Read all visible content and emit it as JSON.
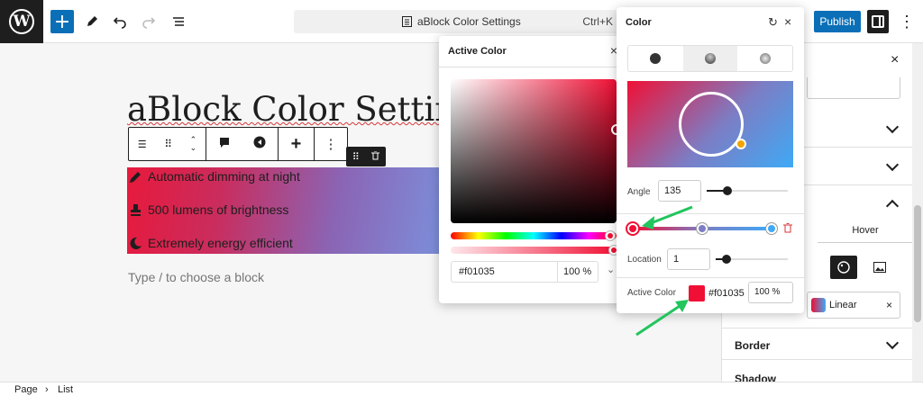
{
  "topbar": {
    "logo_text": "W",
    "doc_title": "aBlock Color Settings",
    "shortcut": "Ctrl+K",
    "publish_label": "Publish",
    "add_label": "+",
    "kebab": "⋮"
  },
  "editor": {
    "title": "aBlock Color Setting",
    "list_items": [
      {
        "icon": "pencil-icon",
        "text": "Automatic dimming at night"
      },
      {
        "icon": "lamp-icon",
        "text": "500 lumens of brightness"
      },
      {
        "icon": "moon-star-icon",
        "text": "Extremely energy efficient"
      }
    ],
    "placeholder": "Type / to choose a block"
  },
  "active_color_popover": {
    "title": "Active Color",
    "hex": "#f01035",
    "opacity": "100 %",
    "close": "×"
  },
  "color_popover": {
    "title": "Color",
    "angle_label": "Angle",
    "angle_value": "135",
    "angle_slider_level": 0.25,
    "location_label": "Location",
    "location_value": "1",
    "location_slider_level": 0.01,
    "active_color_label": "Active Color",
    "active_color_hex": "#f01035",
    "active_color_opacity": "100 %",
    "close": "×",
    "gradient_stops": [
      "#f01035",
      "#7c7dc4",
      "#3fa9f5"
    ]
  },
  "sidebar": {
    "close": "×",
    "hover_tab": "Hover",
    "gradient_type": "Linear",
    "border_label": "Border",
    "shadow_label": "Shadow"
  },
  "footer": {
    "crumb_page": "Page",
    "crumb_list": "List"
  },
  "colors": {
    "accent": "#0a6fb7",
    "active": "#f01035",
    "arrow": "#22c55e"
  }
}
